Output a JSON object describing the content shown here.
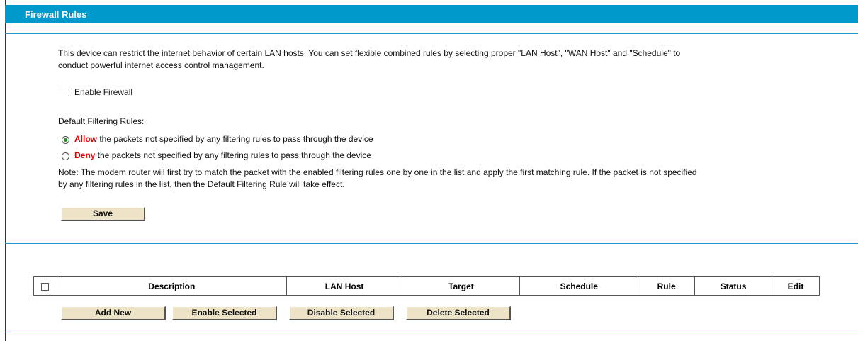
{
  "header": {
    "title": "Firewall Rules"
  },
  "intro": {
    "line1": "This device can restrict the internet behavior of certain LAN hosts. You can set flexible combined rules by selecting proper \"LAN Host\", \"WAN Host\" and \"Schedule\" to",
    "line2": "conduct powerful internet access control management."
  },
  "enable_firewall": {
    "label": "Enable Firewall",
    "checked": false
  },
  "default_rules": {
    "label": "Default Filtering Rules:",
    "allow": {
      "keyword": "Allow",
      "text": " the packets not specified by any filtering rules to pass through the device",
      "checked": true
    },
    "deny": {
      "keyword": "Deny",
      "text": " the packets not specified by any filtering rules to pass through the device",
      "checked": false
    }
  },
  "note": {
    "line1": "Note: The modem router will first try to match the packet with the enabled filtering rules one by one in the list and apply the first matching rule. If the packet is not specified",
    "line2": "by any filtering rules in the list, then the Default Filtering Rule will take effect."
  },
  "save_label": "Save",
  "table": {
    "columns": [
      "Description",
      "LAN Host",
      "Target",
      "Schedule",
      "Rule",
      "Status",
      "Edit"
    ]
  },
  "actions": {
    "add_new": "Add New",
    "enable_selected": "Enable Selected",
    "disable_selected": "Disable Selected",
    "delete_selected": "Delete Selected"
  }
}
